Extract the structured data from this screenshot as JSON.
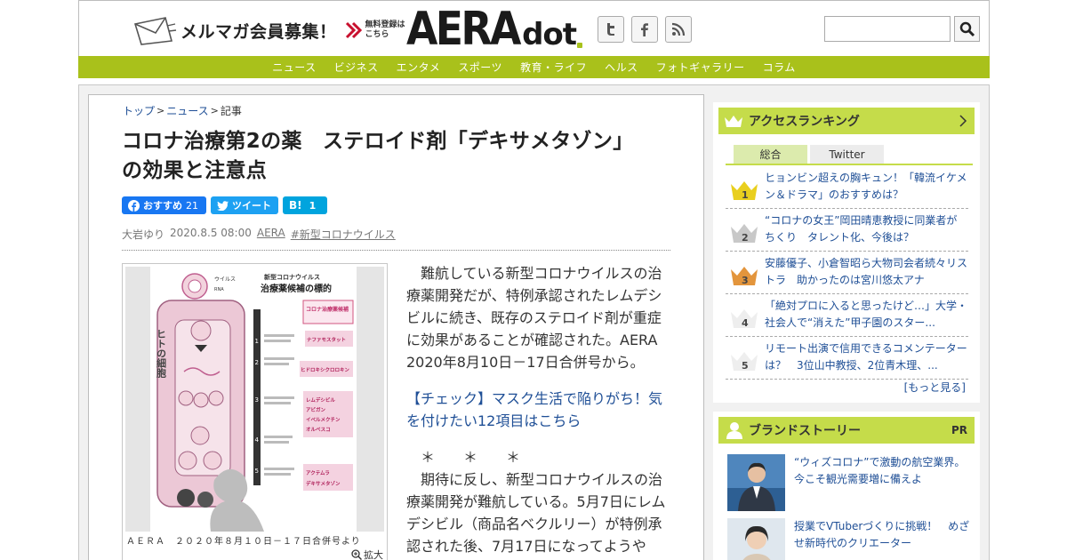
{
  "header": {
    "mailmag_title": "メルマガ会員募集！",
    "mailmag_sub_1": "無料登録は",
    "mailmag_sub_2": "こちら",
    "logo_main": "AERA",
    "logo_sub": "dot",
    "search_placeholder": ""
  },
  "nav": {
    "items": [
      "ニュース",
      "ビジネス",
      "エンタメ",
      "スポーツ",
      "教育・ライフ",
      "ヘルス",
      "フォトギャラリー",
      "コラム"
    ]
  },
  "breadcrumb": {
    "home": "トップ",
    "section": "ニュース",
    "current": "記事"
  },
  "article": {
    "title_line1": "コロナ治療第2の薬　ステロイド剤「デキサメタゾン」",
    "title_line2": "の効果と注意点",
    "share": {
      "fb_label": "おすすめ",
      "fb_count": "21",
      "tw_label": "ツイート",
      "hb_label": "B!",
      "hb_count": "1"
    },
    "author": "大岩ゆり",
    "date": "2020.8.5 08:00",
    "outlet": "AERA",
    "tag": "#新型コロナウイルス",
    "figure_caption": "ＡＥＲＡ　２０２０年８月１０日－１７日合併号より",
    "figure_zoom": "拡大",
    "para1": "　難航している新型コロナウイルスの治療薬開発だが、特例承認されたレムデシビルに続き、既存のステロイド剤が重症に効果があることが確認された。AERA 2020年8月10日－17日合併号から。",
    "link_text": "【チェック】マスク生活で陥りがち！気を付けたい12項目はこちら",
    "stars": "　＊　　＊　　＊",
    "para2": "　期待に反し、新型コロナウイルスの治療薬開発が難航している。5月7日にレムデシビル（商品名ベクルリー）が特例承認された後、7月17日になってようや"
  },
  "figure_text": {
    "title_small": "新型コロナウイルス",
    "title_big": "治療薬候補の標的",
    "label_virus": "ウイルス",
    "label_rna": "RNA",
    "label_cell": "ヒトの細胞",
    "candidates_title": "コロナ治療薬候補",
    "drug_1": "ナファモスタット",
    "drug_2": "ヒドロキシクロロキン",
    "drug_3a": "レムデシビル",
    "drug_3b": "アビガン",
    "drug_3c": "イベルメクチン",
    "drug_3d": "オルベスコ",
    "drug_5a": "アクテムラ",
    "drug_5b": "デキサメタゾン",
    "step_1": "1",
    "step_2": "2",
    "step_3": "3",
    "step_4": "4",
    "step_5": "5"
  },
  "ranking": {
    "title": "アクセスランキング",
    "tab_all": "総合",
    "tab_twitter": "Twitter",
    "items": [
      {
        "rank": "1",
        "text": "ヒョンビン超えの胸キュン！「韓流イケメン＆ドラマ」のおすすめは？"
      },
      {
        "rank": "2",
        "text": "“コロナの女王”岡田晴恵教授に同業者がちくり　タレント化、今後は？"
      },
      {
        "rank": "3",
        "text": "安藤優子、小倉智昭ら大物司会者続々リストラ　助かったのは宮川悠太アナ"
      },
      {
        "rank": "4",
        "text": "「絶対プロに入ると思ったけど…」大学・社会人で“消えた”甲子園のスター..."
      },
      {
        "rank": "5",
        "text": "リモート出演で信用できるコメンテーターは？　3位山中教授、2位青木理、..."
      }
    ],
    "more": "[もっと見る]"
  },
  "brand": {
    "title": "ブランドストーリー",
    "pr": "PR",
    "items": [
      {
        "text": "“ウィズコロナ”で激動の航空業界。今こそ観光需要増に備えよ"
      },
      {
        "text": "授業でVTuberづくりに挑戦！　めざせ新時代のクリエーター"
      }
    ]
  },
  "colors": {
    "accent_green": "#a9c11b",
    "panel_head": "#c5dc4a",
    "link_blue": "#1f4f96",
    "facebook": "#1877f2",
    "twitter": "#1da1f2",
    "hatena": "#00a4de"
  },
  "icons": [
    "envelope-icon",
    "chevron-right-icon",
    "twitter-icon",
    "facebook-icon",
    "rss-icon",
    "search-icon",
    "crown-icon",
    "person-icon",
    "zoom-icon"
  ]
}
